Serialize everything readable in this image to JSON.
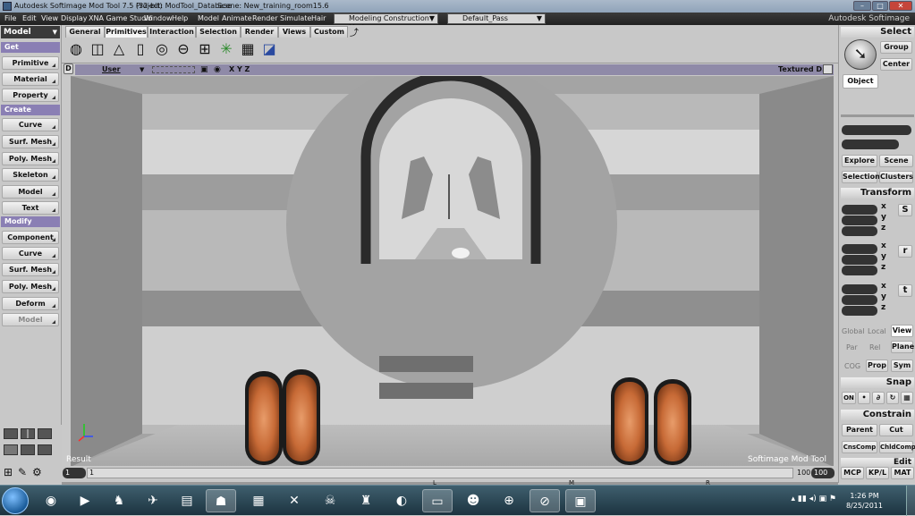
{
  "titlebar": {
    "title": "Autodesk Softimage Mod Tool 7.5 (32-bit)",
    "project": "Project: ModTool_Database",
    "scene": "Scene: New_training_room15.6",
    "buttons": [
      "–",
      "□",
      "✕"
    ]
  },
  "menubar": {
    "items": [
      "File",
      "Edit",
      "View",
      "Display",
      "XNA Game Studio",
      "Window",
      "Help",
      "Model",
      "Animate",
      "Render",
      "Simulate",
      "Hair"
    ],
    "mode_combo": "Modeling Construction Mode",
    "pass_combo": "Default_Pass",
    "brand": "Autodesk Softimage"
  },
  "leftpanel": {
    "module": "Model",
    "get_head": "Get",
    "get_items": [
      "Primitive",
      "Material",
      "Property"
    ],
    "create_head": "Create",
    "create_items": [
      "Curve",
      "Surf. Mesh",
      "Poly. Mesh",
      "Skeleton",
      "Model",
      "Text"
    ],
    "modify_head": "Modify",
    "modify_items": [
      "Component",
      "Curve",
      "Surf. Mesh",
      "Poly. Mesh",
      "Deform",
      "Model"
    ]
  },
  "tabs": [
    "General",
    "Primitives",
    "Interaction",
    "Selection",
    "Render",
    "Views",
    "Custom"
  ],
  "viewport": {
    "camera": "User",
    "axes": "X Y Z",
    "display_mode": "Textured D...",
    "result_label": "Result",
    "watermark": "Softimage Mod Tool",
    "letter": "D"
  },
  "timeline": {
    "start_frame": "1",
    "start_field": "1",
    "end_frame": "100",
    "end_field": "100",
    "markers": [
      "L",
      "M",
      "R"
    ]
  },
  "rightpanel": {
    "select_head": "Select",
    "group_btn": "Group",
    "center_btn": "Center",
    "object_btn": "Object",
    "explore_btn": "Explore",
    "scene_btn": "Scene",
    "selection_btn": "Selection",
    "clusters_btn": "Clusters",
    "transform_head": "Transform",
    "axis_labels": [
      "x",
      "y",
      "z"
    ],
    "srt_labels": [
      "S",
      "r",
      "t"
    ],
    "global_btn": "Global",
    "local_btn": "Local",
    "view_btn": "View",
    "par_btn": "Par",
    "rel_btn": "Rel",
    "plane_btn": "Plane",
    "cog_btn": "COG",
    "prop_btn": "Prop",
    "sym_btn": "Sym",
    "snap_head": "Snap",
    "on_btn": "ON",
    "constrain_head": "Constrain",
    "parent_btn": "Parent",
    "cut_btn": "Cut",
    "cnscomp_btn": "CnsComp",
    "chldcomp_btn": "ChldComp",
    "edit_head": "Edit",
    "bottom_tabs": [
      "MCP",
      "KP/L",
      "MAT"
    ]
  },
  "taskbar": {
    "time": "1:26 PM",
    "date": "8/25/2011"
  }
}
